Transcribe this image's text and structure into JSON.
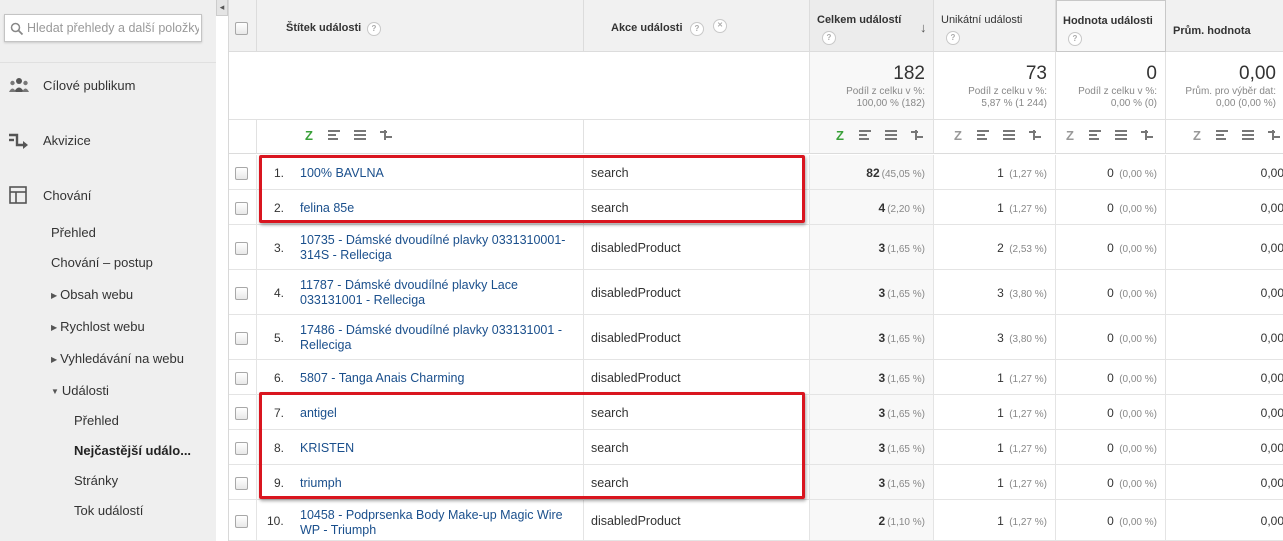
{
  "sidebar": {
    "search_placeholder": "Hledat přehledy a další položky",
    "main_items": [
      {
        "label": "Cílové publikum",
        "icon": "people-icon"
      },
      {
        "label": "Akvizice",
        "icon": "acquisition-icon"
      },
      {
        "label": "Chování",
        "icon": "behavior-icon"
      }
    ],
    "sub_items": [
      {
        "label": "Přehled"
      },
      {
        "label": "Chování – postup"
      },
      {
        "label": "Obsah webu",
        "expander": "▶"
      },
      {
        "label": "Rychlost webu",
        "expander": "▶"
      },
      {
        "label": "Vyhledávání na webu",
        "expander": "▶"
      },
      {
        "label": "Události",
        "expander": "▼"
      }
    ],
    "event_items": [
      {
        "label": "Přehled"
      },
      {
        "label": "Nejčastější událo...",
        "active": true
      },
      {
        "label": "Stránky"
      },
      {
        "label": "Tok událostí"
      }
    ],
    "collapse_glyph": "◂"
  },
  "table": {
    "columns": {
      "label": "Štítek události",
      "action": "Akce události",
      "total": "Celkem událostí",
      "unique": "Unikátní události",
      "value": "Hodnota události",
      "avg": "Prům. hodnota"
    },
    "help_glyph": "?",
    "remove_glyph": "✕",
    "sort_glyph": "↓",
    "totals": {
      "total": {
        "value": "182",
        "line1": "Podíl z celku v %:",
        "line2": "100,00 % (182)"
      },
      "unique": {
        "value": "73",
        "line1": "Podíl z celku v %:",
        "line2": "5,87 % (1 244)"
      },
      "value": {
        "value": "0",
        "line1": "Podíl z celku v %:",
        "line2": "0,00 % (0)"
      },
      "avg": {
        "value": "0,00",
        "line1": "Prům. pro výběr dat:",
        "line2": "0,00 (0,00 %)"
      }
    },
    "view_icon_z": "Z",
    "rows": [
      {
        "num": "1.",
        "label": "100% BAVLNA",
        "action": "search",
        "total": "82",
        "total_pct": "(45,05 %)",
        "unique": "1",
        "unique_pct": "(1,27 %)",
        "value": "0",
        "value_pct": "(0,00 %)",
        "avg": "0,00"
      },
      {
        "num": "2.",
        "label": "felina 85e",
        "action": "search",
        "total": "4",
        "total_pct": "(2,20 %)",
        "unique": "1",
        "unique_pct": "(1,27 %)",
        "value": "0",
        "value_pct": "(0,00 %)",
        "avg": "0,00"
      },
      {
        "num": "3.",
        "label": "10735 - Dámské dvoudílné plavky 0331310001-314S - Relleciga",
        "action": "disabledProduct",
        "total": "3",
        "total_pct": "(1,65 %)",
        "unique": "2",
        "unique_pct": "(2,53 %)",
        "value": "0",
        "value_pct": "(0,00 %)",
        "avg": "0,00"
      },
      {
        "num": "4.",
        "label": "11787 - Dámské dvoudílné plavky Lace 033131001 - Relleciga",
        "action": "disabledProduct",
        "total": "3",
        "total_pct": "(1,65 %)",
        "unique": "3",
        "unique_pct": "(3,80 %)",
        "value": "0",
        "value_pct": "(0,00 %)",
        "avg": "0,00"
      },
      {
        "num": "5.",
        "label": "17486 - Dámské dvoudílné plavky 033131001 - Relleciga",
        "action": "disabledProduct",
        "total": "3",
        "total_pct": "(1,65 %)",
        "unique": "3",
        "unique_pct": "(3,80 %)",
        "value": "0",
        "value_pct": "(0,00 %)",
        "avg": "0,00"
      },
      {
        "num": "6.",
        "label": "5807 - Tanga Anais Charming",
        "action": "disabledProduct",
        "total": "3",
        "total_pct": "(1,65 %)",
        "unique": "1",
        "unique_pct": "(1,27 %)",
        "value": "0",
        "value_pct": "(0,00 %)",
        "avg": "0,00"
      },
      {
        "num": "7.",
        "label": "antigel",
        "action": "search",
        "total": "3",
        "total_pct": "(1,65 %)",
        "unique": "1",
        "unique_pct": "(1,27 %)",
        "value": "0",
        "value_pct": "(0,00 %)",
        "avg": "0,00"
      },
      {
        "num": "8.",
        "label": "KRISTEN",
        "action": "search",
        "total": "3",
        "total_pct": "(1,65 %)",
        "unique": "1",
        "unique_pct": "(1,27 %)",
        "value": "0",
        "value_pct": "(0,00 %)",
        "avg": "0,00"
      },
      {
        "num": "9.",
        "label": "triumph",
        "action": "search",
        "total": "3",
        "total_pct": "(1,65 %)",
        "unique": "1",
        "unique_pct": "(1,27 %)",
        "value": "0",
        "value_pct": "(0,00 %)",
        "avg": "0,00"
      },
      {
        "num": "10.",
        "label": "10458 - Podprsenka Body Make-up Magic Wire WP - Triumph",
        "action": "disabledProduct",
        "total": "2",
        "total_pct": "(1,10 %)",
        "unique": "1",
        "unique_pct": "(1,27 %)",
        "value": "0",
        "value_pct": "(0,00 %)",
        "avg": "0,00"
      }
    ]
  },
  "colors": {
    "link": "#1a4f8c",
    "highlight": "#d9151f",
    "active_view": "#3aa13a"
  }
}
